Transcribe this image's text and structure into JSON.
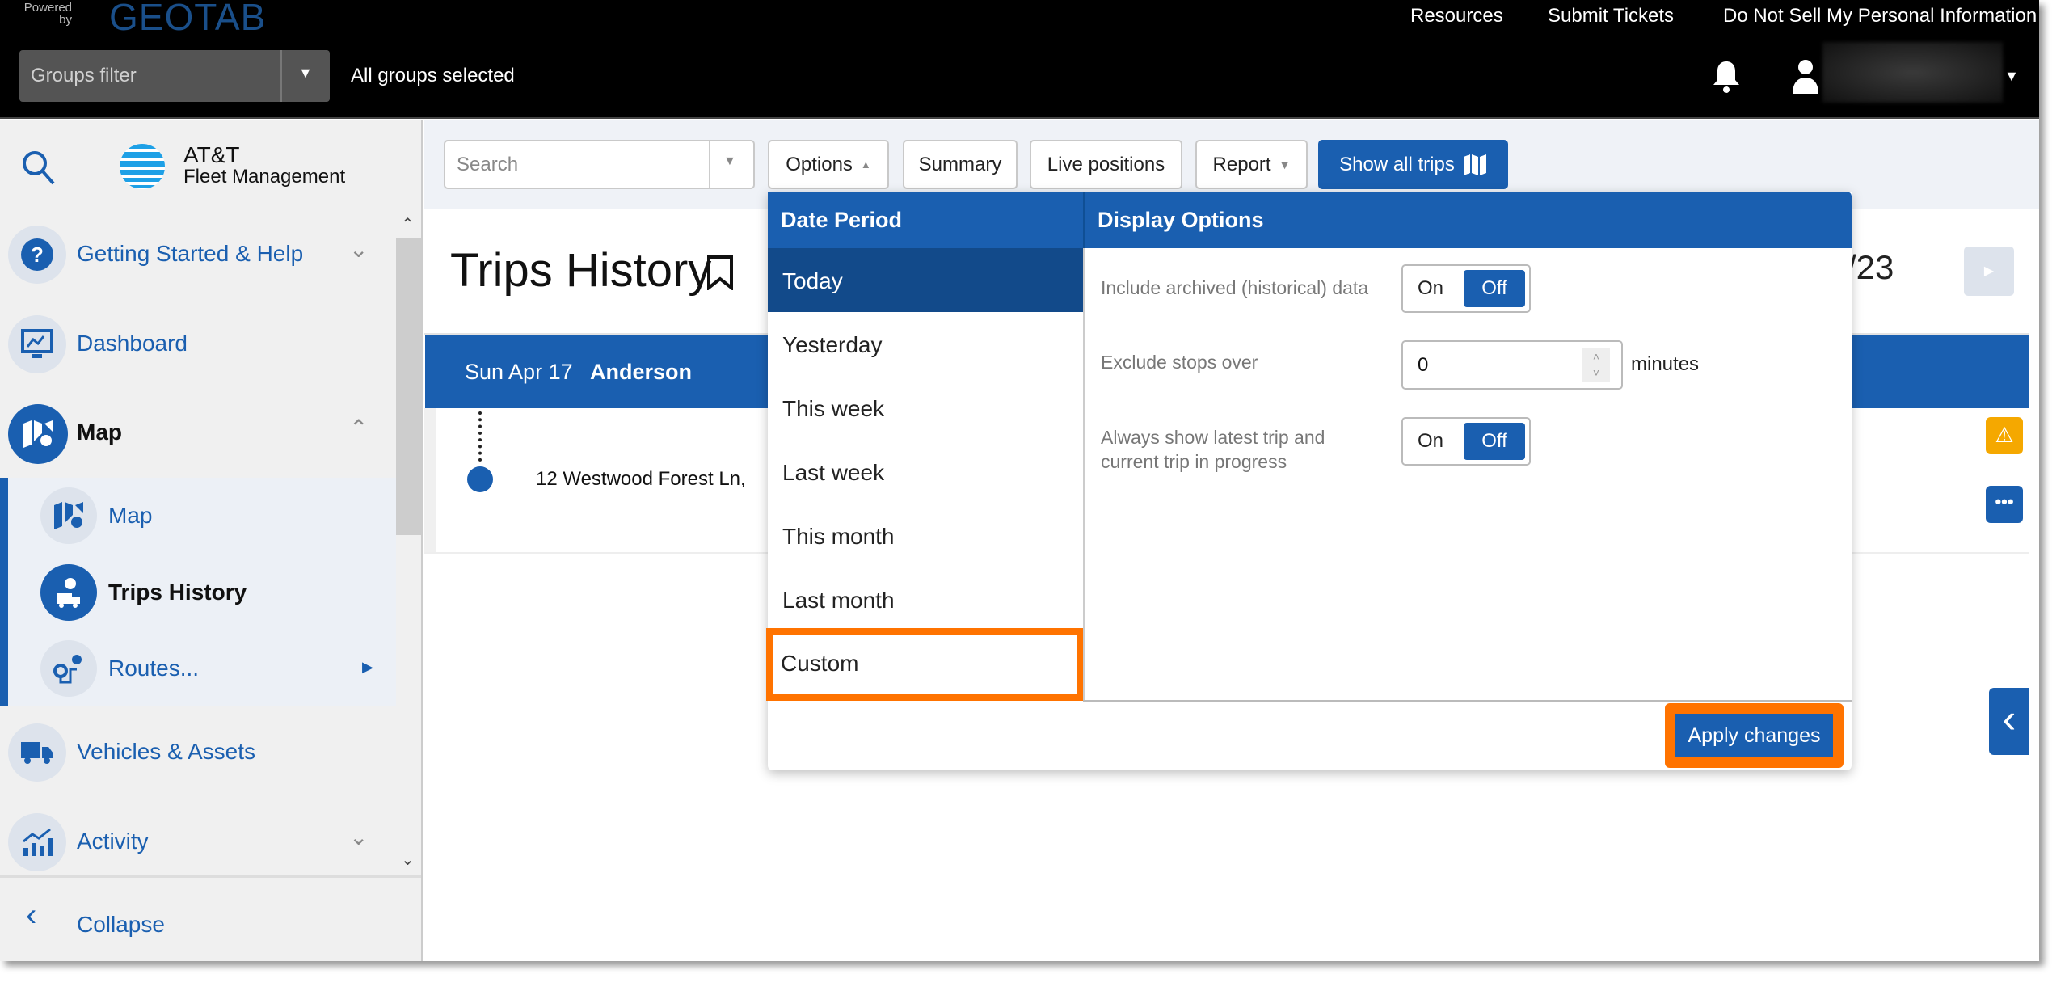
{
  "topbar": {
    "logo_powered": "Powered by",
    "logo_brand": "GEOTAB",
    "groups_filter_placeholder": "Groups filter",
    "groups_status": "All groups selected",
    "links": [
      "Resources",
      "Submit Tickets",
      "Do Not Sell My Personal Information"
    ]
  },
  "sidebar": {
    "brand_line1": "AT&T",
    "brand_line2": "Fleet Management",
    "items": [
      {
        "label": "Getting Started & Help",
        "icon": "help-icon"
      },
      {
        "label": "Dashboard",
        "icon": "dashboard-icon"
      },
      {
        "label": "Map",
        "icon": "map-icon"
      },
      {
        "label": "Vehicles & Assets",
        "icon": "truck-icon"
      },
      {
        "label": "Activity",
        "icon": "activity-icon"
      }
    ],
    "subitems": [
      {
        "label": "Map"
      },
      {
        "label": "Trips History"
      },
      {
        "label": "Routes..."
      }
    ],
    "collapse": "Collapse"
  },
  "toolbar": {
    "search_placeholder": "Search",
    "options": "Options",
    "summary": "Summary",
    "live_positions": "Live positions",
    "report": "Report",
    "show_all_trips": "Show all trips"
  },
  "page": {
    "title": "Trips History",
    "date_fragment": "/23"
  },
  "trips": {
    "header_date": "Sun Apr 17",
    "header_driver": "Anderson",
    "address": "12 Westwood Forest Ln,"
  },
  "dropdown": {
    "date_period_title": "Date Period",
    "date_periods": [
      "Today",
      "Yesterday",
      "This week",
      "Last week",
      "This month",
      "Last month",
      "Custom"
    ],
    "selected": "Today",
    "highlighted": "Custom",
    "display_title": "Display Options",
    "opt_archived": "Include archived (historical) data",
    "opt_exclude": "Exclude stops over",
    "exclude_value": "0",
    "exclude_unit": "minutes",
    "opt_latest_1": "Always show latest trip and",
    "opt_latest_2": "current trip in progress",
    "on": "On",
    "off": "Off",
    "apply": "Apply changes"
  },
  "colors": {
    "accent": "#1a5fb0",
    "selected": "#124a8a",
    "highlight": "#ff7300",
    "warning": "#f5a800"
  }
}
